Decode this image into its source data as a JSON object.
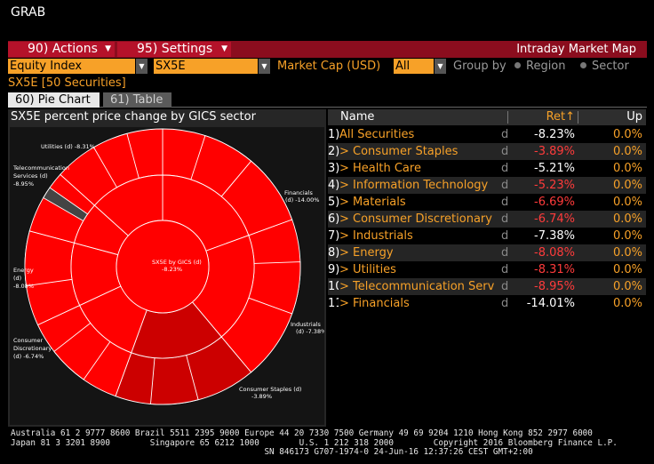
{
  "app": {
    "title": "GRAB"
  },
  "menubar": {
    "actions_label": "90) Actions",
    "settings_label": "95) Settings",
    "right_label": "Intraday Market Map"
  },
  "filters": {
    "index_type": "Equity Index",
    "ticker": "SX5E",
    "metric_label": "Market Cap (USD)",
    "scope": "All",
    "group_by_label": "Group by",
    "region_label": "Region",
    "sector_label": "Sector"
  },
  "securities_label": "SX5E [50 Securities]",
  "tabs": [
    {
      "label": "60) Pie Chart"
    },
    {
      "label": "61) Table"
    }
  ],
  "chart": {
    "title": "SX5E percent price change by GICS sector"
  },
  "chart_data": {
    "type": "pie",
    "center_label_line1": "SX5E by GICS (d)",
    "center_label_line2": "-8.23%",
    "slices": [
      {
        "name": "Financials",
        "label_line1": "Financials",
        "label_line2": "(d) -14.00%",
        "value": -14.0
      },
      {
        "name": "Industrials",
        "label_line1": "Industrials",
        "label_line2": "(d) -7.38%",
        "value": -7.38
      },
      {
        "name": "Consumer Staples",
        "label_line1": "Consumer Staples (d)",
        "label_line2": "-3.89%",
        "value": -3.89
      },
      {
        "name": "Consumer Discretionary",
        "label_line1": "Consumer",
        "label_line2": "Discretionary",
        "label_line3": "(d) -6.74%",
        "value": -6.74
      },
      {
        "name": "Energy",
        "label_line1": "Energy",
        "label_line2": "(d)",
        "label_line3": "-8.08%",
        "value": -8.08
      },
      {
        "name": "Telecommunication Services",
        "label_line1": "Telecommunication",
        "label_line2": "Services (d)",
        "label_line3": "-8.95%",
        "value": -8.95
      },
      {
        "name": "Utilities",
        "label_line1": "Utilities (d) -8.31%",
        "value": -8.31
      }
    ],
    "colors": {
      "strong_negative": "#ff0000",
      "mild_negative": "#cc0000",
      "neutral": "#444444",
      "border": "#ffffff"
    }
  },
  "table": {
    "columns": {
      "name": "Name",
      "ret": "Ret↑",
      "up": "Up"
    },
    "rows": [
      {
        "idx": "1)",
        "name": "All Securities",
        "d": "d",
        "ret": "-8.23%",
        "up": "0.0%",
        "ret_color": "#ffffff",
        "name_prefix": ""
      },
      {
        "idx": "2)",
        "name": "> Consumer Staples",
        "d": "d",
        "ret": "-3.89%",
        "up": "0.0%",
        "ret_color": "#ff3b3b"
      },
      {
        "idx": "3)",
        "name": "> Health Care",
        "d": "d",
        "ret": "-5.21%",
        "up": "0.0%",
        "ret_color": "#ffffff"
      },
      {
        "idx": "4)",
        "name": "> Information Technology",
        "d": "d",
        "ret": "-5.23%",
        "up": "0.0%",
        "ret_color": "#ff3b3b"
      },
      {
        "idx": "5)",
        "name": "> Materials",
        "d": "d",
        "ret": "-6.69%",
        "up": "0.0%",
        "ret_color": "#ff3b3b"
      },
      {
        "idx": "6)",
        "name": "> Consumer Discretionary",
        "d": "d",
        "ret": "-6.74%",
        "up": "0.0%",
        "ret_color": "#ff3b3b"
      },
      {
        "idx": "7)",
        "name": "> Industrials",
        "d": "d",
        "ret": "-7.38%",
        "up": "0.0%",
        "ret_color": "#ffffff"
      },
      {
        "idx": "8)",
        "name": "> Energy",
        "d": "d",
        "ret": "-8.08%",
        "up": "0.0%",
        "ret_color": "#ff3b3b"
      },
      {
        "idx": "9)",
        "name": "> Utilities",
        "d": "d",
        "ret": "-8.31%",
        "up": "0.0%",
        "ret_color": "#ff3b3b"
      },
      {
        "idx": "10)",
        "name": "> Telecommunication Serv",
        "d": "d",
        "ret": "-8.95%",
        "up": "0.0%",
        "ret_color": "#ff3b3b"
      },
      {
        "idx": "11)",
        "name": "> Financials",
        "d": "d",
        "ret": "-14.01%",
        "up": "0.0%",
        "ret_color": "#ffffff"
      }
    ]
  },
  "footer": {
    "line1": "Australia 61 2 9777 8600 Brazil 5511 2395 9000 Europe 44 20 7330 7500 Germany 49 69 9204 1210 Hong Kong 852 2977 6000",
    "line2": "Japan 81 3 3201 8900        Singapore 65 6212 1000        U.S. 1 212 318 2000        Copyright 2016 Bloomberg Finance L.P.",
    "line3": "                                                   SN 846173 G707-1974-0 24-Jun-16 12:37:26 CEST GMT+2:00"
  }
}
